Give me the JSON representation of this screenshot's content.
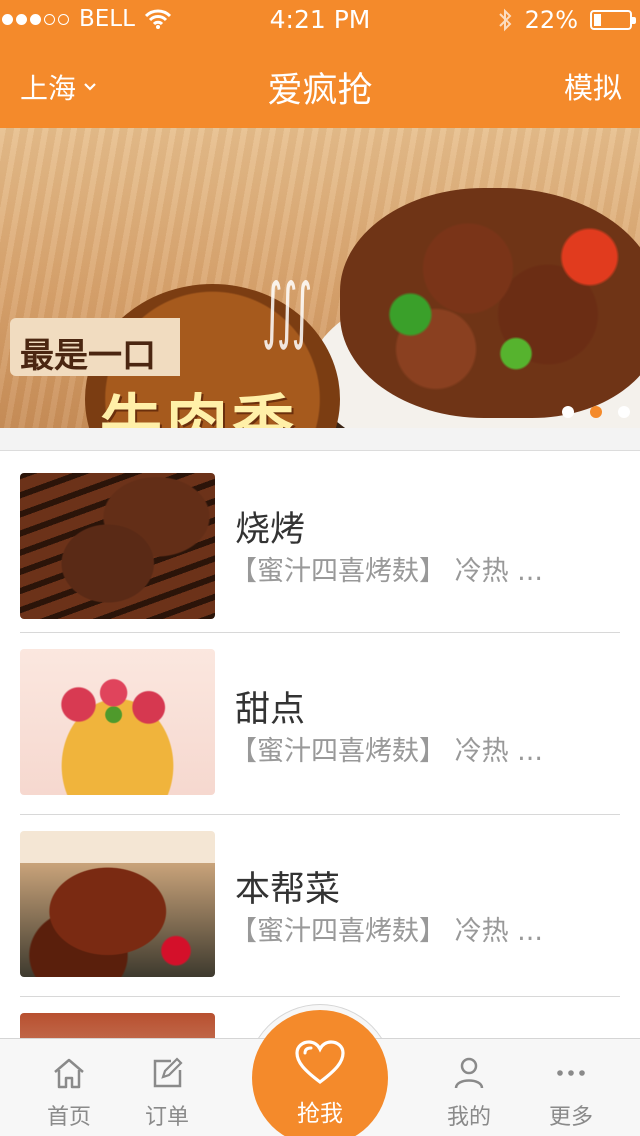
{
  "status_bar": {
    "carrier": "BELL",
    "time": "4:21 PM",
    "battery": "22%",
    "battery_level": 0.22,
    "signal_bars": 3,
    "signal_total": 5
  },
  "nav": {
    "city": "上海",
    "title": "爱疯抢",
    "right": "模拟"
  },
  "banner": {
    "top_text": "最是一口",
    "main_text": "牛肉香",
    "slides": 3,
    "active_slide": 2
  },
  "categories": [
    {
      "title": "烧烤",
      "desc": "【蜜汁四喜烤麸】 冷热 ...",
      "thumb": "bbq-image"
    },
    {
      "title": "甜点",
      "desc": "【蜜汁四喜烤麸】 冷热 ...",
      "thumb": "dessert-image"
    },
    {
      "title": "本帮菜",
      "desc": "【蜜汁四喜烤麸】 冷热 ...",
      "thumb": "crab-image"
    },
    {
      "title": "",
      "desc": "",
      "thumb": "partial-image"
    }
  ],
  "tabs": {
    "home": "首页",
    "orders": "订单",
    "grab": "抢我",
    "mine": "我的",
    "more": "更多"
  },
  "colors": {
    "brand": "#f48a2b",
    "tab_text": "#8a8a8a"
  }
}
